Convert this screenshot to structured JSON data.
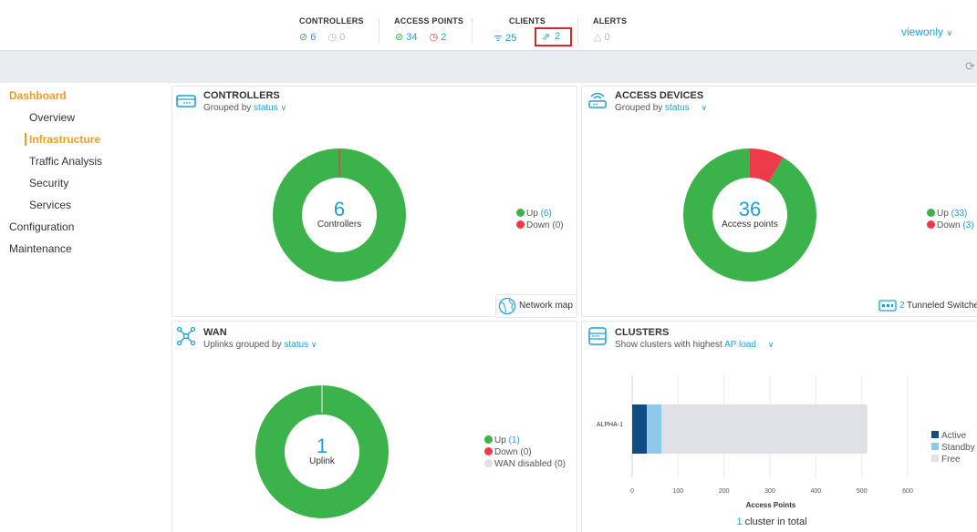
{
  "topbar": {
    "controllers": {
      "title": "CONTROLLERS",
      "up": "6",
      "down": "0"
    },
    "access_points": {
      "title": "ACCESS POINTS",
      "up": "34",
      "down": "2"
    },
    "clients": {
      "title": "CLIENTS",
      "wireless": "25",
      "remote": "2"
    },
    "alerts": {
      "title": "ALERTS",
      "count": "0"
    },
    "user": "viewonly"
  },
  "sidebar": {
    "dashboard": "Dashboard",
    "overview": "Overview",
    "infrastructure": "Infrastructure",
    "traffic": "Traffic Analysis",
    "security": "Security",
    "services": "Services",
    "configuration": "Configuration",
    "maintenance": "Maintenance"
  },
  "controllers_card": {
    "title": "CONTROLLERS",
    "grouped_by": "Grouped by",
    "group_value": "status",
    "center_value": "6",
    "center_label": "Controllers",
    "legend_up": "Up",
    "legend_up_count": "(6)",
    "legend_down": "Down",
    "legend_down_count": "(0)",
    "network_map": "Network map",
    "up": 6,
    "down": 0
  },
  "access_card": {
    "title": "ACCESS DEVICES",
    "grouped_by": "Grouped by",
    "group_value": "status",
    "center_value": "36",
    "center_label": "Access points",
    "legend_up": "Up",
    "legend_up_count": "(33)",
    "legend_down": "Down",
    "legend_down_count": "(3)",
    "tunneled_count": "2",
    "tunneled_label": "Tunneled Switche",
    "up": 33,
    "down": 3
  },
  "wan_card": {
    "title": "WAN",
    "grouped_by": "Uplinks grouped by",
    "group_value": "status",
    "center_value": "1",
    "center_label": "Uplink",
    "legend_up": "Up",
    "legend_up_count": "(1)",
    "legend_down": "Down",
    "legend_down_count": "(0)",
    "legend_disabled": "WAN disabled (0)",
    "up": 1,
    "down": 0,
    "disabled": 0
  },
  "clusters_card": {
    "title": "CLUSTERS",
    "subtitle": "Show clusters with highest",
    "group_value": "AP load",
    "total_count": "1",
    "total_label": "cluster in total"
  },
  "colors": {
    "up": "#3cb34a",
    "down": "#ee3a4a",
    "accent": "#1e9fd8",
    "nav_active": "#f29b1d",
    "active": "#0f4c81",
    "standby": "#8ec9ea",
    "free": "#dfe1e4"
  },
  "chart_data": {
    "type": "bar",
    "orientation": "horizontal",
    "stacked": true,
    "categories": [
      "ALPHA-1"
    ],
    "series": [
      {
        "name": "Active",
        "values": [
          32
        ]
      },
      {
        "name": "Standby",
        "values": [
          32
        ]
      },
      {
        "name": "Free",
        "values": [
          448
        ]
      }
    ],
    "xlabel": "Access Points",
    "xlim": [
      0,
      600
    ],
    "xticks": [
      "0",
      "100",
      "200",
      "300",
      "400",
      "500",
      "600"
    ],
    "legend": "right",
    "grid": true
  }
}
